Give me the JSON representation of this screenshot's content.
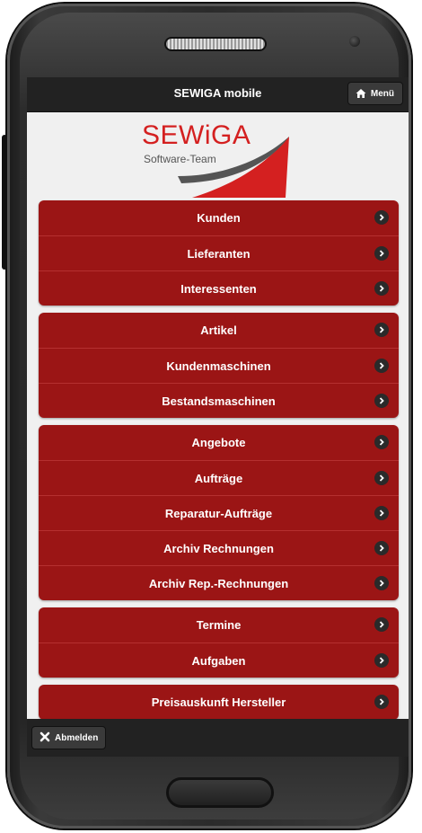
{
  "header": {
    "title": "SEWIGA mobile",
    "menu_label": "Menü"
  },
  "logo": {
    "brand": "SEWiGA",
    "tagline": "Software-Team"
  },
  "groups": [
    {
      "items": [
        {
          "label": "Kunden"
        },
        {
          "label": "Lieferanten"
        },
        {
          "label": "Interessenten"
        }
      ]
    },
    {
      "items": [
        {
          "label": "Artikel"
        },
        {
          "label": "Kundenmaschinen"
        },
        {
          "label": "Bestandsmaschinen"
        }
      ]
    },
    {
      "items": [
        {
          "label": "Angebote"
        },
        {
          "label": "Aufträge"
        },
        {
          "label": "Reparatur-Aufträge"
        },
        {
          "label": "Archiv Rechnungen"
        },
        {
          "label": "Archiv Rep.-Rechnungen"
        }
      ]
    },
    {
      "items": [
        {
          "label": "Termine"
        },
        {
          "label": "Aufgaben"
        }
      ]
    },
    {
      "items": [
        {
          "label": "Preisauskunft Hersteller"
        }
      ]
    }
  ],
  "footer": {
    "logout_label": "Abmelden"
  },
  "colors": {
    "accent": "#9b1515",
    "bar": "#222222",
    "logo_red": "#d42020"
  },
  "icons": {
    "menu": "home-icon",
    "item": "chevron-right-icon",
    "logout": "close-icon"
  }
}
